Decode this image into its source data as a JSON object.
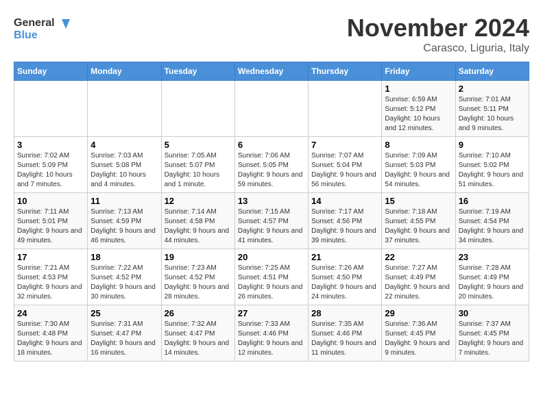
{
  "header": {
    "logo_line1": "General",
    "logo_line2": "Blue",
    "month": "November 2024",
    "location": "Carasco, Liguria, Italy"
  },
  "weekdays": [
    "Sunday",
    "Monday",
    "Tuesday",
    "Wednesday",
    "Thursday",
    "Friday",
    "Saturday"
  ],
  "weeks": [
    [
      {
        "day": "",
        "info": ""
      },
      {
        "day": "",
        "info": ""
      },
      {
        "day": "",
        "info": ""
      },
      {
        "day": "",
        "info": ""
      },
      {
        "day": "",
        "info": ""
      },
      {
        "day": "1",
        "info": "Sunrise: 6:59 AM\nSunset: 5:12 PM\nDaylight: 10 hours and 12 minutes."
      },
      {
        "day": "2",
        "info": "Sunrise: 7:01 AM\nSunset: 5:11 PM\nDaylight: 10 hours and 9 minutes."
      }
    ],
    [
      {
        "day": "3",
        "info": "Sunrise: 7:02 AM\nSunset: 5:09 PM\nDaylight: 10 hours and 7 minutes."
      },
      {
        "day": "4",
        "info": "Sunrise: 7:03 AM\nSunset: 5:08 PM\nDaylight: 10 hours and 4 minutes."
      },
      {
        "day": "5",
        "info": "Sunrise: 7:05 AM\nSunset: 5:07 PM\nDaylight: 10 hours and 1 minute."
      },
      {
        "day": "6",
        "info": "Sunrise: 7:06 AM\nSunset: 5:05 PM\nDaylight: 9 hours and 59 minutes."
      },
      {
        "day": "7",
        "info": "Sunrise: 7:07 AM\nSunset: 5:04 PM\nDaylight: 9 hours and 56 minutes."
      },
      {
        "day": "8",
        "info": "Sunrise: 7:09 AM\nSunset: 5:03 PM\nDaylight: 9 hours and 54 minutes."
      },
      {
        "day": "9",
        "info": "Sunrise: 7:10 AM\nSunset: 5:02 PM\nDaylight: 9 hours and 51 minutes."
      }
    ],
    [
      {
        "day": "10",
        "info": "Sunrise: 7:11 AM\nSunset: 5:01 PM\nDaylight: 9 hours and 49 minutes."
      },
      {
        "day": "11",
        "info": "Sunrise: 7:13 AM\nSunset: 4:59 PM\nDaylight: 9 hours and 46 minutes."
      },
      {
        "day": "12",
        "info": "Sunrise: 7:14 AM\nSunset: 4:58 PM\nDaylight: 9 hours and 44 minutes."
      },
      {
        "day": "13",
        "info": "Sunrise: 7:15 AM\nSunset: 4:57 PM\nDaylight: 9 hours and 41 minutes."
      },
      {
        "day": "14",
        "info": "Sunrise: 7:17 AM\nSunset: 4:56 PM\nDaylight: 9 hours and 39 minutes."
      },
      {
        "day": "15",
        "info": "Sunrise: 7:18 AM\nSunset: 4:55 PM\nDaylight: 9 hours and 37 minutes."
      },
      {
        "day": "16",
        "info": "Sunrise: 7:19 AM\nSunset: 4:54 PM\nDaylight: 9 hours and 34 minutes."
      }
    ],
    [
      {
        "day": "17",
        "info": "Sunrise: 7:21 AM\nSunset: 4:53 PM\nDaylight: 9 hours and 32 minutes."
      },
      {
        "day": "18",
        "info": "Sunrise: 7:22 AM\nSunset: 4:52 PM\nDaylight: 9 hours and 30 minutes."
      },
      {
        "day": "19",
        "info": "Sunrise: 7:23 AM\nSunset: 4:52 PM\nDaylight: 9 hours and 28 minutes."
      },
      {
        "day": "20",
        "info": "Sunrise: 7:25 AM\nSunset: 4:51 PM\nDaylight: 9 hours and 26 minutes."
      },
      {
        "day": "21",
        "info": "Sunrise: 7:26 AM\nSunset: 4:50 PM\nDaylight: 9 hours and 24 minutes."
      },
      {
        "day": "22",
        "info": "Sunrise: 7:27 AM\nSunset: 4:49 PM\nDaylight: 9 hours and 22 minutes."
      },
      {
        "day": "23",
        "info": "Sunrise: 7:28 AM\nSunset: 4:49 PM\nDaylight: 9 hours and 20 minutes."
      }
    ],
    [
      {
        "day": "24",
        "info": "Sunrise: 7:30 AM\nSunset: 4:48 PM\nDaylight: 9 hours and 18 minutes."
      },
      {
        "day": "25",
        "info": "Sunrise: 7:31 AM\nSunset: 4:47 PM\nDaylight: 9 hours and 16 minutes."
      },
      {
        "day": "26",
        "info": "Sunrise: 7:32 AM\nSunset: 4:47 PM\nDaylight: 9 hours and 14 minutes."
      },
      {
        "day": "27",
        "info": "Sunrise: 7:33 AM\nSunset: 4:46 PM\nDaylight: 9 hours and 12 minutes."
      },
      {
        "day": "28",
        "info": "Sunrise: 7:35 AM\nSunset: 4:46 PM\nDaylight: 9 hours and 11 minutes."
      },
      {
        "day": "29",
        "info": "Sunrise: 7:36 AM\nSunset: 4:45 PM\nDaylight: 9 hours and 9 minutes."
      },
      {
        "day": "30",
        "info": "Sunrise: 7:37 AM\nSunset: 4:45 PM\nDaylight: 9 hours and 7 minutes."
      }
    ]
  ]
}
